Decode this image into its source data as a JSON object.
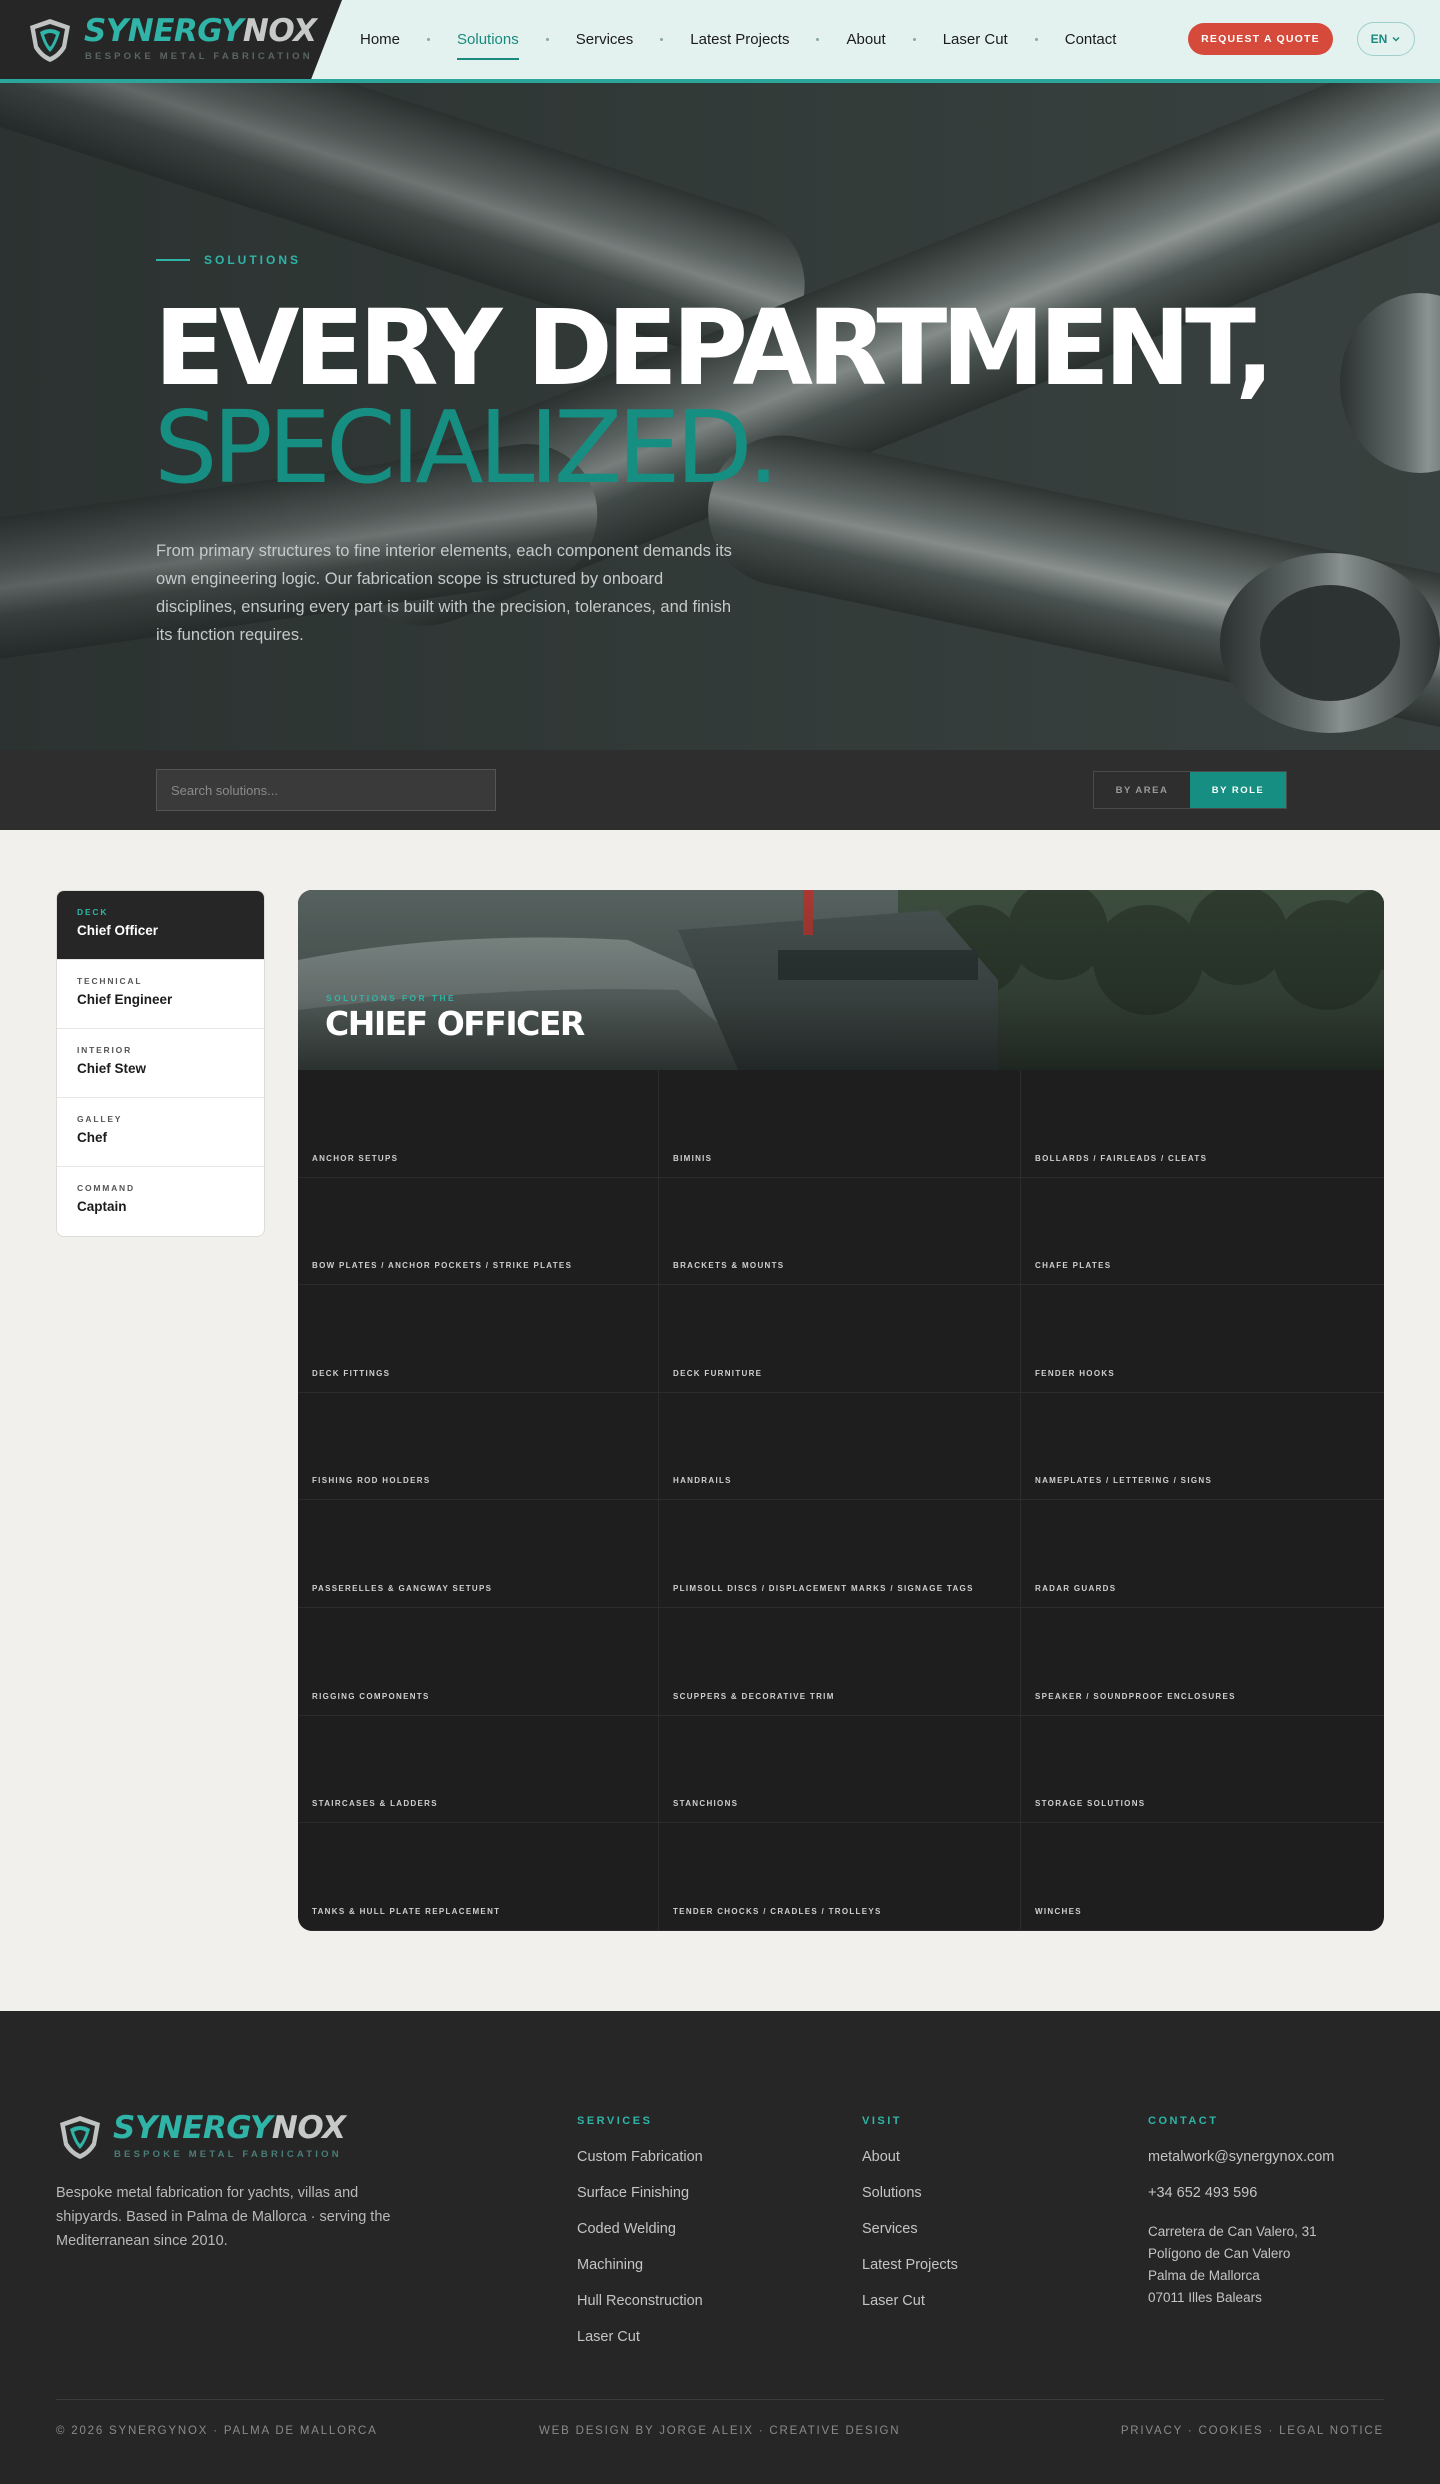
{
  "brand": {
    "name_part1": "SYNERGY",
    "name_part2": "NOX",
    "tagline": "BESPOKE METAL FABRICATION",
    "accent_color": "#2fb4a7",
    "cta_color": "#d64a3b"
  },
  "nav": {
    "items": [
      {
        "label": "Home",
        "active": false
      },
      {
        "label": "Solutions",
        "active": true
      },
      {
        "label": "Services",
        "active": false
      },
      {
        "label": "Latest Projects",
        "active": false
      },
      {
        "label": "About",
        "active": false
      },
      {
        "label": "Laser Cut",
        "active": false
      },
      {
        "label": "Contact",
        "active": false
      }
    ],
    "cta_label": "REQUEST A QUOTE",
    "language": "EN"
  },
  "hero": {
    "eyebrow": "SOLUTIONS",
    "title_line1": "EVERY DEPARTMENT,",
    "title_line2": "SPECIALIZED.",
    "description": "From primary structures to fine interior elements, each component demands its own engineering logic. Our fabrication scope is structured by onboard disciplines, ensuring every part is built with the precision, tolerances, and finish its function requires."
  },
  "filters": {
    "search_placeholder": "Search solutions...",
    "toggle_by_area": "BY AREA",
    "toggle_by_role": "BY ROLE",
    "selected": "BY ROLE"
  },
  "roles": [
    {
      "category": "DECK",
      "name": "Chief Officer",
      "active": true
    },
    {
      "category": "TECHNICAL",
      "name": "Chief Engineer",
      "active": false
    },
    {
      "category": "INTERIOR",
      "name": "Chief Stew",
      "active": false
    },
    {
      "category": "GALLEY",
      "name": "Chef",
      "active": false
    },
    {
      "category": "COMMAND",
      "name": "Captain",
      "active": false
    }
  ],
  "panel": {
    "eyebrow": "SOLUTIONS FOR THE",
    "title": "CHIEF OFFICER",
    "items": [
      "ANCHOR SETUPS",
      "BIMINIS",
      "BOLLARDS / FAIRLEADS / CLEATS",
      "BOW PLATES / ANCHOR POCKETS / STRIKE PLATES",
      "BRACKETS & MOUNTS",
      "CHAFE PLATES",
      "DECK FITTINGS",
      "DECK FURNITURE",
      "FENDER HOOKS",
      "FISHING ROD HOLDERS",
      "HANDRAILS",
      "NAMEPLATES / LETTERING / SIGNS",
      "PASSERELLES & GANGWAY SETUPS",
      "PLIMSOLL DISCS / DISPLACEMENT MARKS / SIGNAGE TAGS",
      "RADAR GUARDS",
      "RIGGING COMPONENTS",
      "SCUPPERS & DECORATIVE TRIM",
      "SPEAKER / SOUNDPROOF ENCLOSURES",
      "STAIRCASES & LADDERS",
      "STANCHIONS",
      "STORAGE SOLUTIONS",
      "TANKS & HULL PLATE REPLACEMENT",
      "TENDER CHOCKS / CRADLES / TROLLEYS",
      "WINCHES"
    ]
  },
  "footer": {
    "about": "Bespoke metal fabrication for yachts, villas and shipyards. Based in Palma de Mallorca · serving the Mediterranean since 2010.",
    "services_heading": "SERVICES",
    "services": [
      "Custom Fabrication",
      "Surface Finishing",
      "Coded Welding",
      "Machining",
      "Hull Reconstruction",
      "Laser Cut"
    ],
    "visit_heading": "VISIT",
    "visit": [
      "About",
      "Solutions",
      "Services",
      "Latest Projects",
      "Laser Cut"
    ],
    "contact_heading": "CONTACT",
    "email": "metalwork@synergynox.com",
    "phone": "+34 652 493 596",
    "address": [
      "Carretera de Can Valero, 31",
      "Polígono de Can Valero",
      "Palma de Mallorca",
      "07011 Illes Balears"
    ],
    "copyright": "© 2026 SYNERGYNOX · PALMA DE MALLORCA",
    "credit": "WEB DESIGN BY JORGE ALEIX · CREATIVE DESIGN",
    "legal": "PRIVACY · COOKIES · LEGAL NOTICE"
  }
}
